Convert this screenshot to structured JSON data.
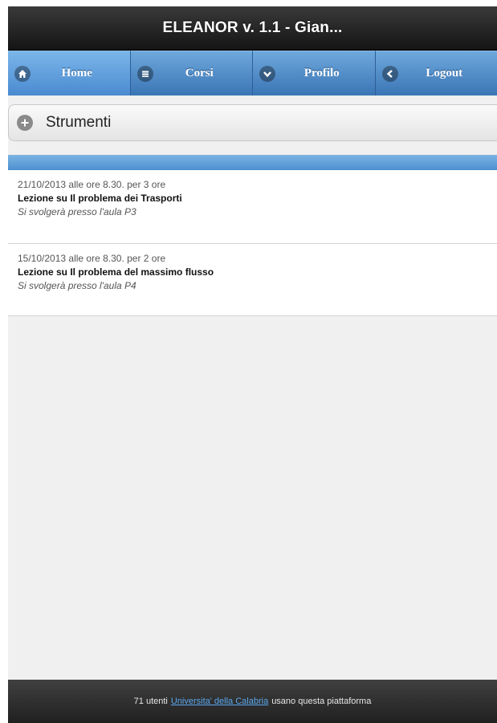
{
  "header": {
    "title": "ELEANOR v. 1.1 - Gian..."
  },
  "navbar": {
    "items": [
      {
        "label": "Home",
        "icon": "home-icon"
      },
      {
        "label": "Corsi",
        "icon": "menu-icon"
      },
      {
        "label": "Profilo",
        "icon": "chevron-down-icon"
      },
      {
        "label": "Logout",
        "icon": "chevron-left-icon"
      }
    ]
  },
  "tools": {
    "label": "Strumenti",
    "icon": "plus-icon"
  },
  "lessons": [
    {
      "date": "21/10/2013 alle ore 8.30. per 3 ore",
      "title": "Lezione su Il problema dei Trasporti",
      "place": "Si svolgerà presso l'aula P3"
    },
    {
      "date": "15/10/2013 alle ore 8.30. per 2 ore",
      "title": "Lezione su Il problema del massimo flusso",
      "place": "Si svolgerà presso l'aula P4"
    }
  ],
  "footer": {
    "prefix": "71 utenti",
    "link": "Universita' della Calabria",
    "suffix": "usano questa piattaforma"
  },
  "colors": {
    "header_bg": "#1e1e1e",
    "nav_blue": "#4a8ad0",
    "divider_blue": "#5f9ed8",
    "footer_bg": "#2e2e2e",
    "link": "#5aa8f0"
  }
}
